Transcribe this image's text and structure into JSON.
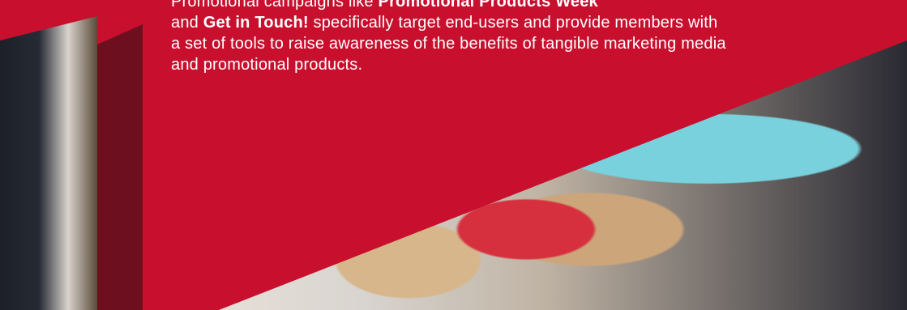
{
  "intro": {
    "prefix": "Promotional campaigns like ",
    "campaign_1": "Promotional Products Week",
    "joiner": "and ",
    "campaign_2": "Get in Touch!",
    "rest": " specifically target end-users and provide members with a set of tools to raise awareness of the benefits of tangible marketing media and promotional products."
  },
  "colors": {
    "brand_red": "#c8102e",
    "shadow_red": "#6e0f1f",
    "text": "#ffffff"
  }
}
